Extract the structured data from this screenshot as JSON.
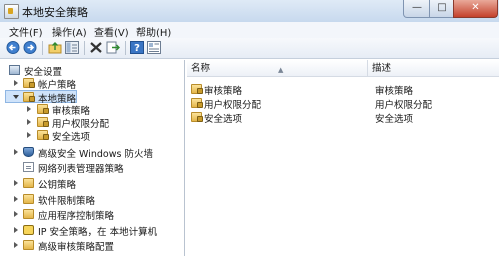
{
  "window": {
    "title": "本地安全策略"
  },
  "caption_buttons": {
    "minimize": "—",
    "maximize": "□",
    "close": "✕"
  },
  "menu": [
    "文件(F)",
    "操作(A)",
    "查看(V)",
    "帮助(H)"
  ],
  "toolbar": [
    "back-icon",
    "forward-icon",
    "up-folder-icon",
    "show-hide-tree-icon",
    "delete-icon",
    "export-list-icon",
    "help-icon",
    "properties-icon"
  ],
  "tree": {
    "root": "安全设置",
    "items": [
      {
        "label": "帐户策略",
        "level": 1,
        "state": "collapsed",
        "icon": "folder"
      },
      {
        "label": "本地策略",
        "level": 1,
        "state": "expanded",
        "icon": "folder",
        "selected": true
      },
      {
        "label": "审核策略",
        "level": 2,
        "state": "collapsed",
        "icon": "folder"
      },
      {
        "label": "用户权限分配",
        "level": 2,
        "state": "collapsed",
        "icon": "folder"
      },
      {
        "label": "安全选项",
        "level": 2,
        "state": "collapsed",
        "icon": "folder"
      },
      {
        "label": "高级安全 Windows 防火墙",
        "level": 1,
        "state": "collapsed",
        "icon": "folder"
      },
      {
        "label": "网络列表管理器策略",
        "level": 1,
        "state": "none",
        "icon": "doc"
      },
      {
        "label": "公钥策略",
        "level": 1,
        "state": "collapsed",
        "icon": "folder"
      },
      {
        "label": "软件限制策略",
        "level": 1,
        "state": "collapsed",
        "icon": "folder"
      },
      {
        "label": "应用程序控制策略",
        "level": 1,
        "state": "collapsed",
        "icon": "folder"
      },
      {
        "label": "IP 安全策略，在 本地计算机",
        "level": 1,
        "state": "collapsed",
        "icon": "ipsec"
      },
      {
        "label": "高级审核策略配置",
        "level": 1,
        "state": "collapsed",
        "icon": "folder"
      }
    ]
  },
  "list": {
    "columns": [
      "名称",
      "描述"
    ],
    "rows": [
      {
        "name": "审核策略",
        "desc": "审核策略"
      },
      {
        "name": "用户权限分配",
        "desc": "用户权限分配"
      },
      {
        "name": "安全选项",
        "desc": "安全选项"
      }
    ]
  }
}
